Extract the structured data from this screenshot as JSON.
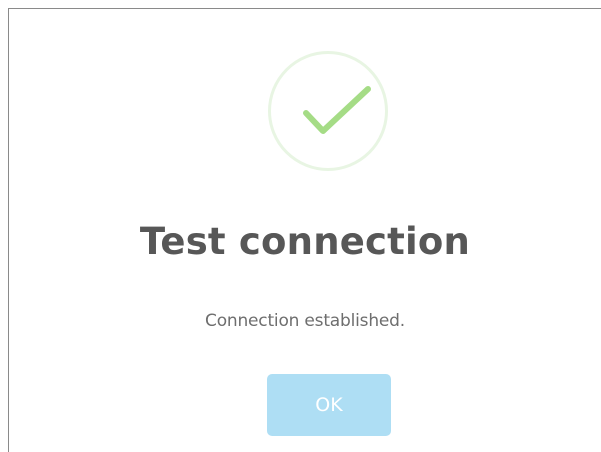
{
  "dialog": {
    "icon": "checkmark-icon",
    "title": "Test connection",
    "message": "Connection established.",
    "ok_label": "OK"
  },
  "colors": {
    "check": "#a5dc86",
    "ring": "#e8f5e3",
    "title": "#575757",
    "message": "#6e6e6e",
    "button_bg": "#aedef4",
    "button_text": "#ffffff"
  }
}
